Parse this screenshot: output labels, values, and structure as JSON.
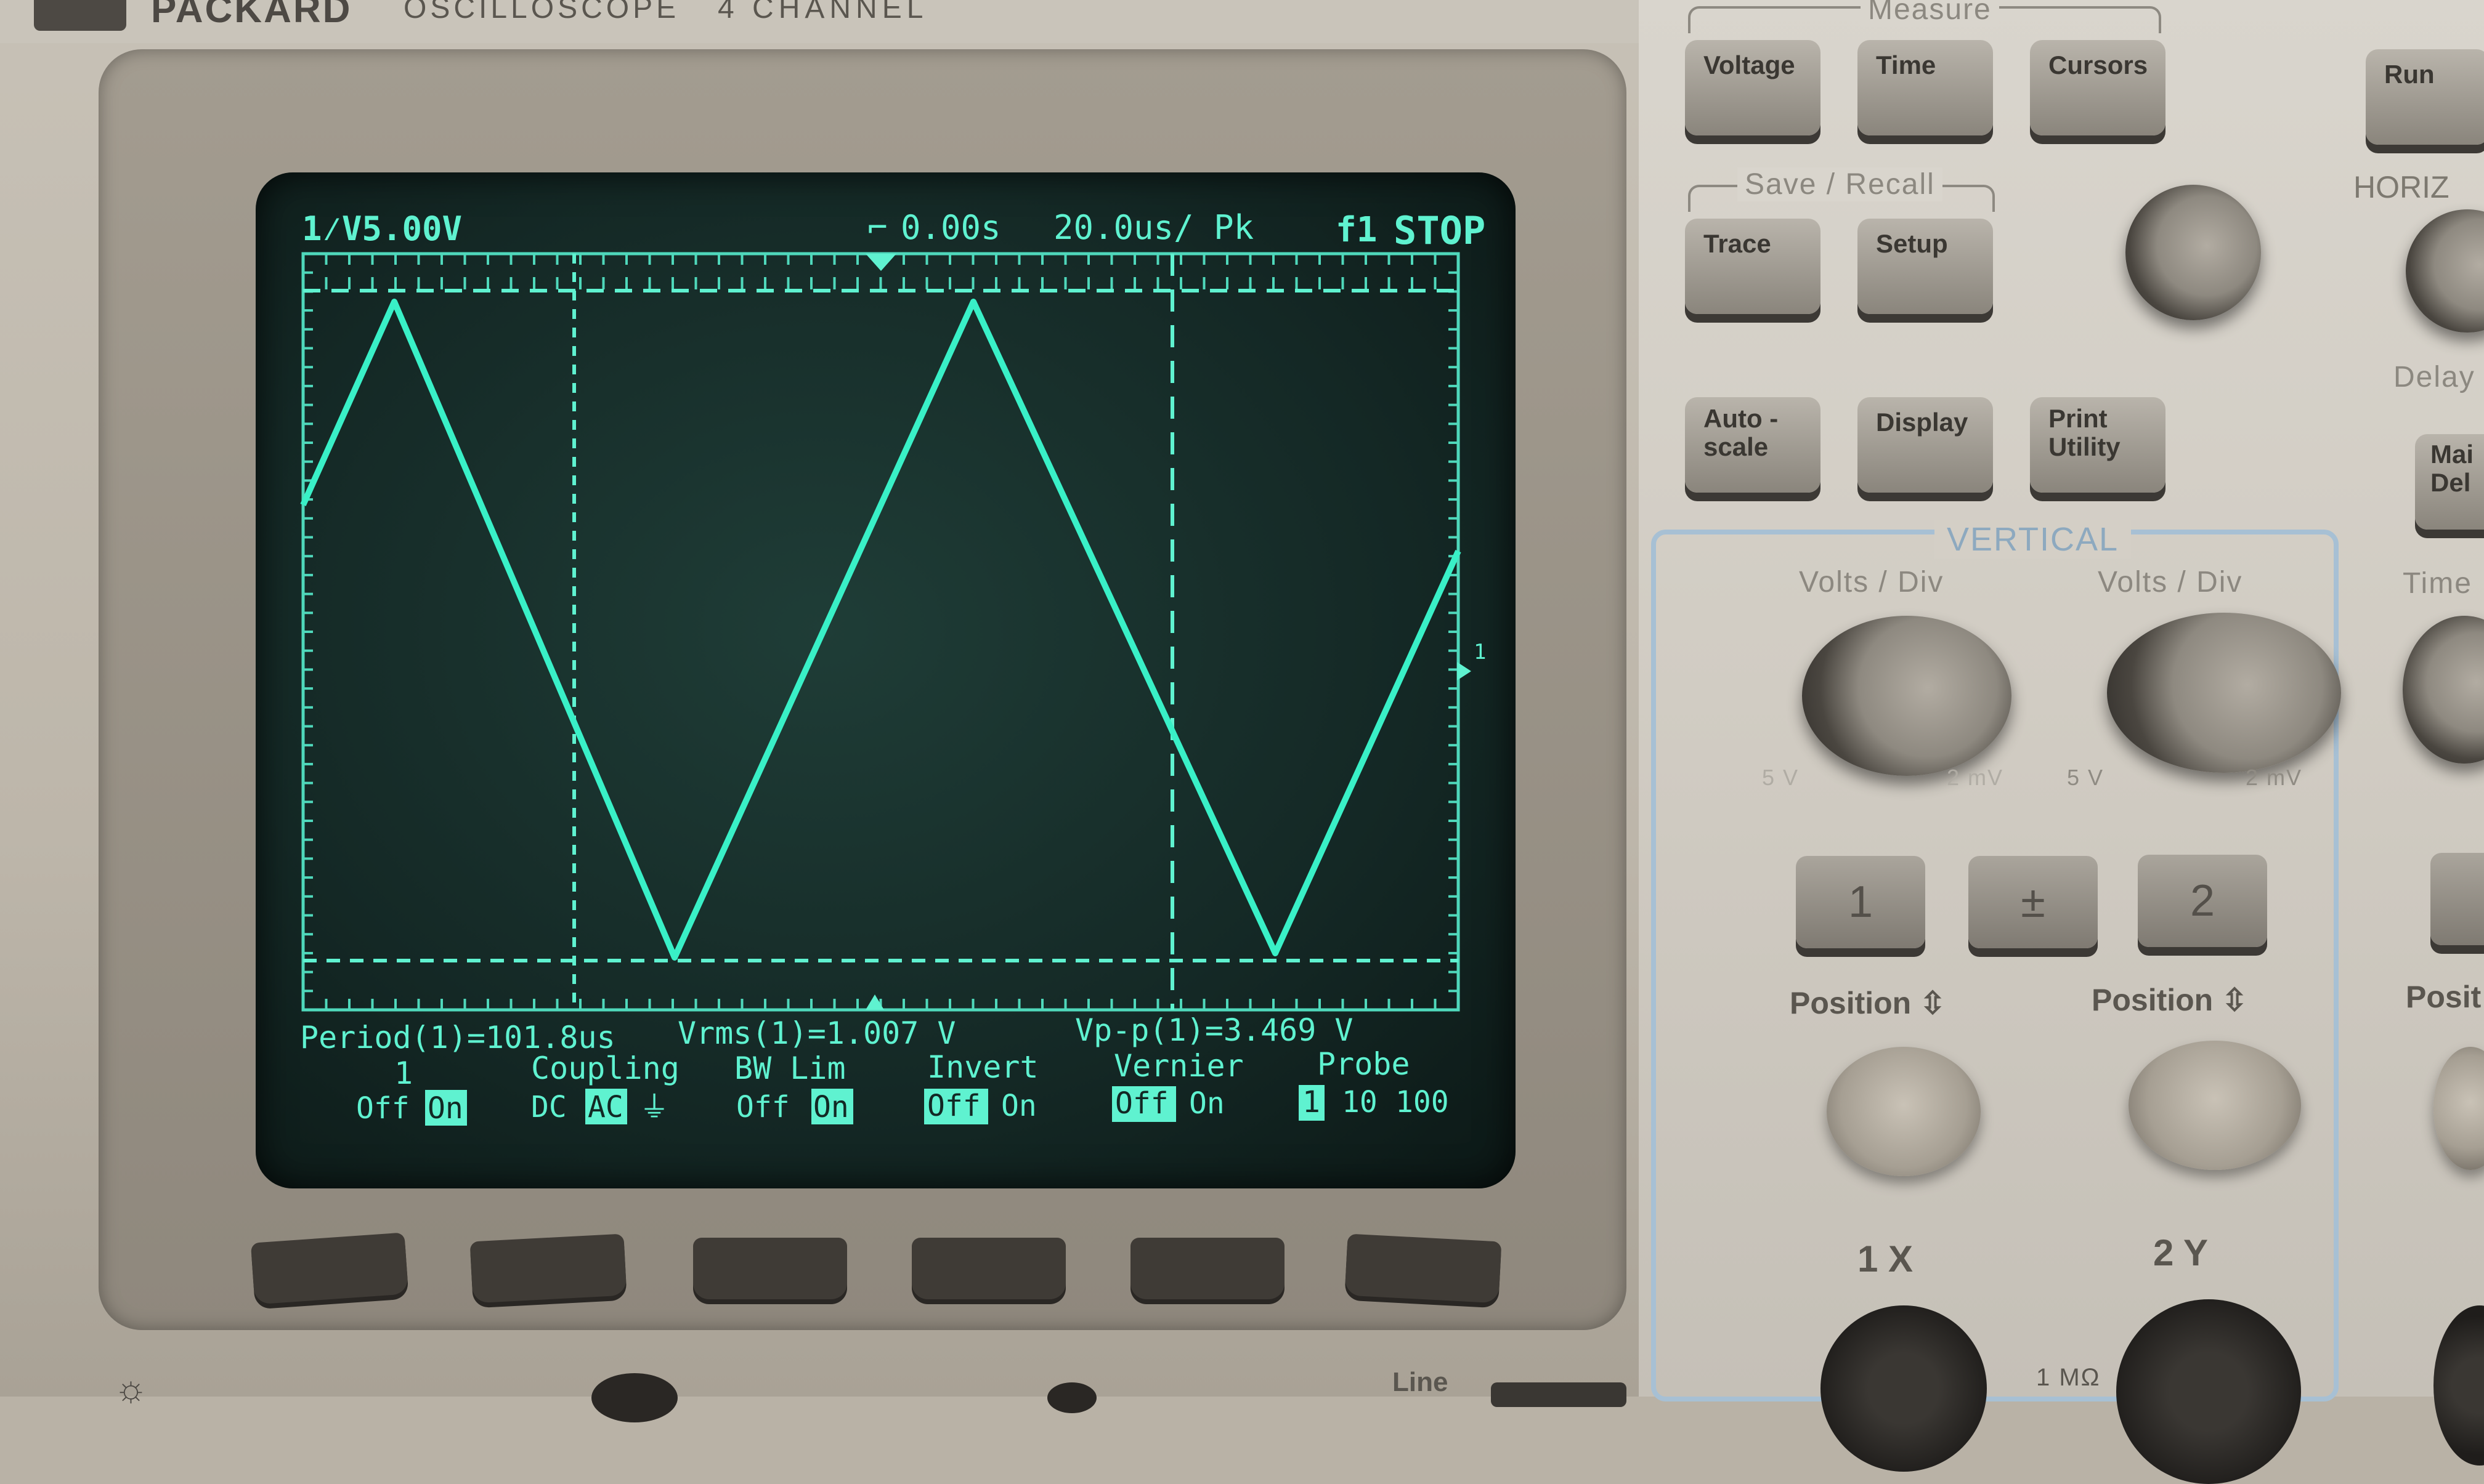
{
  "instrument": {
    "brand": "PACKARD",
    "model": "OSCILLOSCOPE",
    "model_suffix": "4  CHANNEL"
  },
  "screen": {
    "top_left": "1⁄V5.00V",
    "trigger_time": "0.00s",
    "timebase": "20.0us/ Pk",
    "trigger_source": "f1",
    "run_state": "STOP",
    "measurements": {
      "period": "Period(1)=101.8us",
      "vrms": "Vrms(1)=1.007 V",
      "vpp": "Vp-p(1)=3.469 V"
    },
    "menu": {
      "channel": {
        "title": "1",
        "options": [
          "Off",
          "On"
        ],
        "selected": "On"
      },
      "coupling": {
        "title": "Coupling",
        "options": [
          "DC",
          "AC",
          "⏚"
        ],
        "selected": "AC"
      },
      "bw_lim": {
        "title": "BW Lim",
        "options": [
          "Off",
          "On"
        ],
        "selected": "On"
      },
      "invert": {
        "title": "Invert",
        "options": [
          "Off",
          "On"
        ],
        "selected": "Off"
      },
      "vernier": {
        "title": "Vernier",
        "options": [
          "Off",
          "On"
        ],
        "selected": "Off"
      },
      "probe": {
        "title": "Probe",
        "options": [
          "1",
          "10",
          "100"
        ],
        "selected": "1"
      }
    },
    "ground_marker": "1"
  },
  "controls": {
    "measure_label": "Measure",
    "voltage": "Voltage",
    "time": "Time",
    "cursors": "Cursors",
    "run": "Run",
    "save_recall_label": "Save / Recall",
    "trace": "Trace",
    "setup": "Setup",
    "horiz_label": "HORIZ",
    "delay_label": "Delay",
    "autoscale_1": "Auto -",
    "autoscale_2": "scale",
    "display": "Display",
    "print_1": "Print",
    "print_2": "Utility",
    "main_del_1": "Mai",
    "main_del_2": "Del",
    "vertical_label": "VERTICAL",
    "volts_div_1": "Volts / Div",
    "volts_div_2": "Volts / Div",
    "time_label": "Time",
    "range_5v": "5  V",
    "range_2mv": "2  mV",
    "range_5v_b": "5  V",
    "range_2mv_b": "2  mV",
    "ch1_button": "1",
    "math_button": "±",
    "ch2_button": "2",
    "position_1": "Position ⇳",
    "position_2": "Position ⇳",
    "position_3": "Posit",
    "input_1": "1 X",
    "input_2": "2 Y",
    "impedance": "1 MΩ",
    "line": "Line"
  }
}
